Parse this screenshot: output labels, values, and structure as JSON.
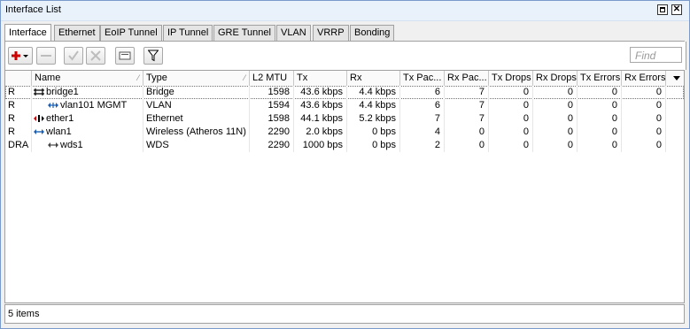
{
  "window": {
    "title": "Interface List"
  },
  "tabs": [
    {
      "label": "Interface",
      "active": true
    },
    {
      "label": "Ethernet"
    },
    {
      "label": "EoIP Tunnel"
    },
    {
      "label": "IP Tunnel"
    },
    {
      "label": "GRE Tunnel"
    },
    {
      "label": "VLAN"
    },
    {
      "label": "VRRP"
    },
    {
      "label": "Bonding"
    }
  ],
  "toolbar": {
    "find_placeholder": "Find",
    "buttons": [
      "add-icon",
      "remove-icon",
      "enable-icon",
      "disable-icon",
      "comment-icon",
      "filter-icon"
    ]
  },
  "table": {
    "columns": [
      "",
      "Name",
      "Type",
      "L2 MTU",
      "Tx",
      "Rx",
      "Tx Pac...",
      "Rx Pac...",
      "Tx Drops",
      "Rx Drops",
      "Tx Errors",
      "Rx Errors"
    ],
    "rows": [
      {
        "flags": "R",
        "icon": "bridge-icon",
        "name": "bridge1",
        "type": "Bridge",
        "l2mtu": "1598",
        "tx": "43.6 kbps",
        "rx": "4.4 kbps",
        "txpac": "6",
        "rxpac": "7",
        "txdrops": "0",
        "rxdrops": "0",
        "txerr": "0",
        "rxerr": "0"
      },
      {
        "flags": "R",
        "icon": "vlan-icon",
        "name": "vlan101 MGMT",
        "type": "VLAN",
        "l2mtu": "1594",
        "tx": "43.6 kbps",
        "rx": "4.4 kbps",
        "txpac": "6",
        "rxpac": "7",
        "txdrops": "0",
        "rxdrops": "0",
        "txerr": "0",
        "rxerr": "0"
      },
      {
        "flags": "R",
        "icon": "ethernet-icon",
        "name": "ether1",
        "type": "Ethernet",
        "l2mtu": "1598",
        "tx": "44.1 kbps",
        "rx": "5.2 kbps",
        "txpac": "7",
        "rxpac": "7",
        "txdrops": "0",
        "rxdrops": "0",
        "txerr": "0",
        "rxerr": "0"
      },
      {
        "flags": "R",
        "icon": "wireless-icon",
        "name": "wlan1",
        "type": "Wireless (Atheros 11N)",
        "l2mtu": "2290",
        "tx": "2.0 kbps",
        "rx": "0 bps",
        "txpac": "4",
        "rxpac": "0",
        "txdrops": "0",
        "rxdrops": "0",
        "txerr": "0",
        "rxerr": "0"
      },
      {
        "flags": "DRA",
        "icon": "wds-icon",
        "name": "wds1",
        "type": "WDS",
        "l2mtu": "2290",
        "tx": "1000 bps",
        "rx": "0 bps",
        "txpac": "2",
        "rxpac": "0",
        "txdrops": "0",
        "rxdrops": "0",
        "txerr": "0",
        "rxerr": "0"
      }
    ]
  },
  "status": {
    "text": "5 items"
  },
  "colors": {
    "title_bar": "#e9f1fb",
    "border": "#7a9acb",
    "add_red": "#cc0000",
    "icon_blue": "#1a5fb4"
  }
}
